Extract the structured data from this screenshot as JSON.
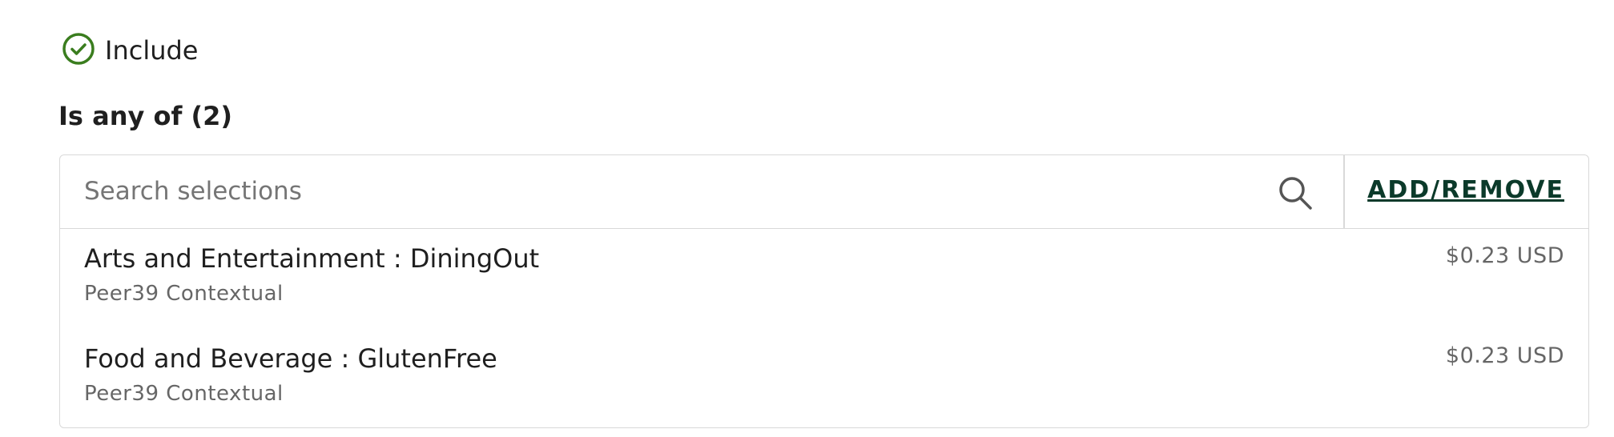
{
  "include": {
    "label": "Include",
    "icon": "check-circle-icon",
    "color": "#3a7d1e"
  },
  "filter": {
    "title": "Is any of (2)"
  },
  "search": {
    "placeholder": "Search selections",
    "value": "",
    "icon": "search-icon"
  },
  "actions": {
    "add_remove_label": "ADD/REMOVE",
    "color": "#0b3a2a"
  },
  "selections": [
    {
      "title": "Arts and Entertainment : DiningOut",
      "source": "Peer39 Contextual",
      "price": "$0.23 USD"
    },
    {
      "title": "Food and Beverage : GlutenFree",
      "source": "Peer39 Contextual",
      "price": "$0.23 USD"
    }
  ]
}
